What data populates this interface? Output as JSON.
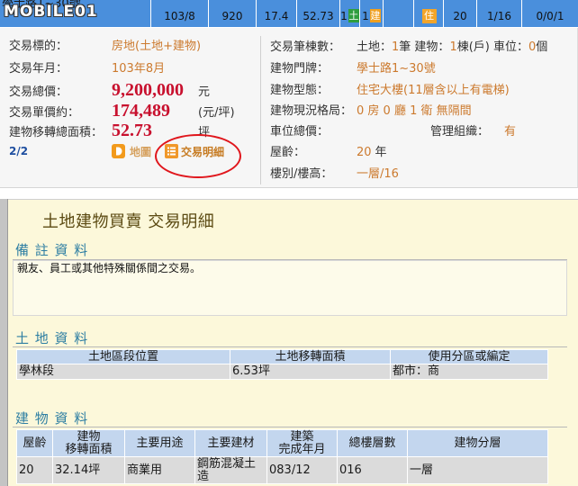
{
  "watermark": "MOBILE01",
  "colors": {
    "summary_bar": "#4a8fdc",
    "value_orange": "#cc7a2e",
    "price_red": "#c8102e",
    "badge_land": "#2f9e3f",
    "badge_building": "#f0a020",
    "badge_use": "#f2a52a",
    "page_link": "#1f4fa0",
    "section_heading": "#2f7fa3",
    "title": "#5b4a12",
    "table_header": "#c3d6ee",
    "table_row": "#dbdbdb",
    "detail_panel": "#fcf8da",
    "annotation_circle": "#e0161c"
  },
  "summary_row": {
    "address": "學士路1~30號",
    "date": "103/8",
    "total_price": "920",
    "unit_price": "17.4",
    "area": "52.73",
    "land_count": "1",
    "land_badge": "土",
    "building_count": "1",
    "building_badge": "建",
    "use_badge": "住",
    "age": "20",
    "floor": "1/16",
    "layout": "0/0/1"
  },
  "overview": {
    "page": "2/2",
    "map_label": "地圖",
    "detail_label": "交易明細",
    "target": {
      "label": "交易標的：",
      "value": "房地(土地+建物)"
    },
    "date": {
      "label": "交易年月：",
      "value": "103年8月"
    },
    "total_price": {
      "label": "交易總價：",
      "value": "9,200,000",
      "unit": "元"
    },
    "unit_price": {
      "label": "交易單價約：",
      "value": "174,489",
      "unit": "(元/坪)"
    },
    "area": {
      "label": "建物移轉總面積：",
      "value": "52.73",
      "unit": "坪"
    },
    "counts": {
      "label": "交易筆棟數：",
      "land_text": "土地：",
      "land_value": "1",
      "building_text": "筆 建物：",
      "building_value": "1",
      "parking_text": "棟(戶) 車位：",
      "parking_value": "0",
      "parking_unit": "個"
    },
    "address": {
      "label": "建物門牌：",
      "value": "學士路1~30號"
    },
    "building_type": {
      "label": "建物型態：",
      "value": "住宅大樓(11層含以上有電梯)"
    },
    "layout": {
      "label": "建物現況格局：",
      "value": "0 房 0 廳 1 衛 無隔間"
    },
    "parking_price": {
      "label": "車位總價："
    },
    "management": {
      "label": "管理組織：",
      "value": "有"
    },
    "age": {
      "label": "屋齡：",
      "value": "20",
      "unit": "年"
    },
    "floor": {
      "label": "樓別/樓高：",
      "value": "一層/16"
    }
  },
  "detail": {
    "title": "土地建物買賣 交易明細",
    "remarks_heading": "備 註 資 料",
    "remarks_text": "親友、員工或其他特殊關係間之交易。",
    "land_heading": "土 地 資 料",
    "land_table": {
      "headers": [
        "土地區段位置",
        "土地移轉面積",
        "使用分區或編定"
      ],
      "rows": [
        [
          "學林段",
          "6.53坪",
          "都市：商"
        ]
      ]
    },
    "building_heading": "建 物 資 料",
    "building_table": {
      "headers": [
        [
          "屋齡"
        ],
        [
          "建物",
          "移轉面積"
        ],
        [
          "主要用途"
        ],
        [
          "主要建材"
        ],
        [
          "建築",
          "完成年月"
        ],
        [
          "總樓層數"
        ],
        [
          "建物分層"
        ]
      ],
      "rows": [
        [
          "20",
          "32.14坪",
          "商業用",
          "鋼筋混凝土造",
          "083/12",
          "016",
          "一層"
        ]
      ]
    }
  }
}
